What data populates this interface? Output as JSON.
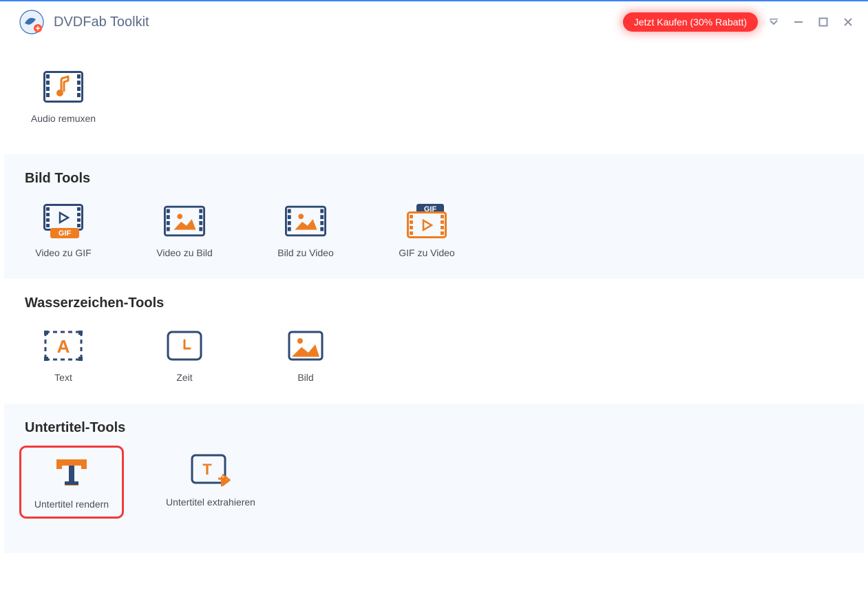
{
  "app": {
    "title": "DVDFab Toolkit"
  },
  "header": {
    "buy_label": "Jetzt Kaufen (30% Rabatt)"
  },
  "sections": {
    "audio": {
      "items": {
        "audio_remuxen": "Audio remuxen"
      }
    },
    "bild": {
      "title": "Bild Tools",
      "items": {
        "video_zu_gif": "Video zu GIF",
        "video_zu_bild": "Video zu Bild",
        "bild_zu_video": "Bild zu Video",
        "gif_zu_video": "GIF zu Video"
      }
    },
    "wasserzeichen": {
      "title": "Wasserzeichen-Tools",
      "items": {
        "text": "Text",
        "zeit": "Zeit",
        "bild": "Bild"
      }
    },
    "untertitel": {
      "title": "Untertitel-Tools",
      "items": {
        "rendern": "Untertitel rendern",
        "extrahieren": "Untertitel extrahieren"
      }
    }
  }
}
